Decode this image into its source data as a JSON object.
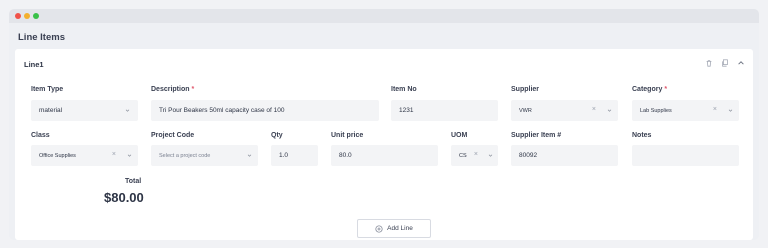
{
  "section_title": "Line Items",
  "line": {
    "title": "Line1",
    "actions": {
      "delete_icon": "trash-icon",
      "duplicate_icon": "copy-icon",
      "collapse_icon": "chevron-up-icon"
    }
  },
  "fields": {
    "item_type": {
      "label": "Item Type",
      "value": "material"
    },
    "description": {
      "label": "Description",
      "required_mark": "*",
      "value": "Tri Pour Beakers 50ml capacity case of 100"
    },
    "item_no": {
      "label": "Item No",
      "value": "1231"
    },
    "supplier": {
      "label": "Supplier",
      "value": "VWR",
      "clear": "×"
    },
    "category": {
      "label": "Category",
      "required_mark": "*",
      "value": "Lab Supplies",
      "clear": "×"
    },
    "class": {
      "label": "Class",
      "value": "Office Supplies",
      "clear": "×"
    },
    "project_code": {
      "label": "Project Code",
      "placeholder": "Select a project code"
    },
    "qty": {
      "label": "Qty",
      "value": "1.0"
    },
    "unit_price": {
      "label": "Unit price",
      "value": "80.0"
    },
    "uom": {
      "label": "UOM",
      "value": "CS",
      "clear": "×"
    },
    "supplier_item": {
      "label": "Supplier Item #",
      "value": "80092"
    },
    "notes": {
      "label": "Notes",
      "value": ""
    }
  },
  "total": {
    "label": "Total",
    "value": "$80.00"
  },
  "add_line": {
    "label": "Add Line",
    "icon": "plus-circle-icon"
  },
  "colors": {
    "required": "#e0566b",
    "field_bg": "#f3f4f6",
    "page_bg": "#f1f2f5"
  }
}
